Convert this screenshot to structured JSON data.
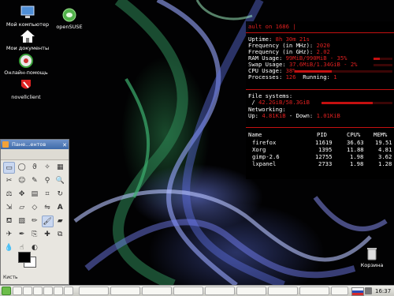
{
  "desktop_icons": [
    {
      "label": "Мой компьютер",
      "icon": "computer-icon"
    },
    {
      "label": "Мои документы",
      "icon": "home-folder-icon"
    },
    {
      "label": "Онлайн-помощь",
      "icon": "help-icon"
    },
    {
      "label": "novellclient",
      "icon": "novell-icon"
    },
    {
      "label": "openSUSE",
      "icon": "opensuse-icon"
    },
    {
      "label": "Корзина",
      "icon": "trash-icon"
    }
  ],
  "conky": {
    "header": "ault on 1686 |",
    "uptime_label": "Uptime:",
    "uptime": "8h 30m 21s",
    "freq_mhz_label": "Frequency (in MHz):",
    "freq_mhz": "2020",
    "freq_ghz_label": "Frequency (in GHz):",
    "freq_ghz": "2.02",
    "ram_label": "RAM Usage:",
    "ram": "99MiB/990MiB - 35%",
    "ram_fraction": 0.35,
    "swap_label": "Swap Usage:",
    "swap": "37.6MiB/1.34GiB - 2%",
    "swap_fraction": 0.02,
    "cpu_label": "CPU Usage:",
    "cpu": "38%",
    "cpu_fraction": 0.38,
    "processes_label": "Processes:",
    "processes": "126",
    "running_label": "Running:",
    "running": "1",
    "fs_label": "File systems:",
    "fs_path": "/",
    "fs_usage": "42.2GiB/58.3GiB",
    "fs_fraction": 0.72,
    "net_label": "Networking:",
    "up_label": "Up:",
    "up": "4.81KiB",
    "down_label": " - Down:",
    "down": "1.01KiB",
    "proc_headers": [
      "Name",
      "PID",
      "CPU%",
      "MEM%"
    ],
    "procs": [
      [
        "firefox",
        "11619",
        "36.63",
        "19.51"
      ],
      [
        "Xorg",
        "1395",
        "11.88",
        "4.81"
      ],
      [
        "gimp-2.6",
        "12755",
        "1.98",
        "3.62"
      ],
      [
        "lxpanel",
        "2733",
        "1.98",
        "1.28"
      ]
    ]
  },
  "toolbox": {
    "title": "Пане...ентов",
    "footer": "Кисть"
  },
  "taskbar": {
    "clock": "16:37"
  },
  "colors": {
    "conky_red": "#e02020",
    "taskbar_bg": "#dcdcd6",
    "toolbox_title": "#4a74b3"
  }
}
